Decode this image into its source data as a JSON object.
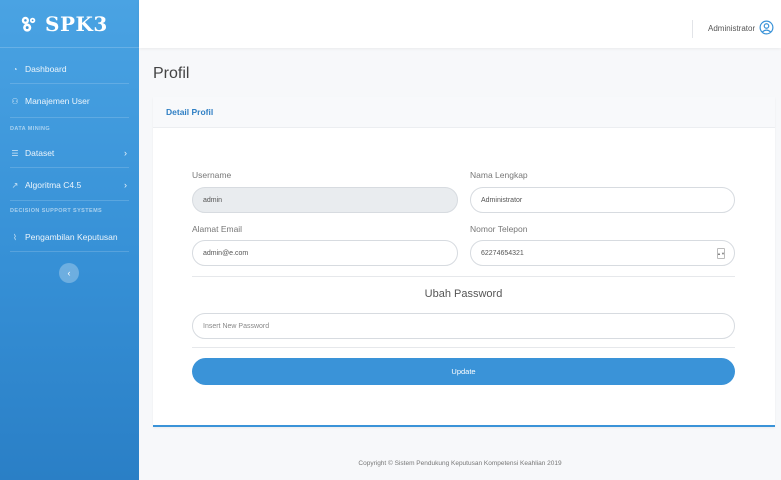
{
  "brand": {
    "name": "SPK3",
    "logo_icon": "gear-cluster-icon"
  },
  "sidebar": {
    "items": [
      {
        "label": "Dashboard",
        "icon": "dashboard-icon"
      },
      {
        "label": "Manajemen User",
        "icon": "users-icon"
      },
      {
        "label": "Dataset",
        "icon": "database-icon"
      },
      {
        "label": "Algoritma C4.5",
        "icon": "wrench-icon"
      },
      {
        "label": "Pengambilan Keputusan",
        "icon": "chart-line-icon"
      }
    ],
    "sections": [
      "DATA MINING",
      "DECISION SUPPORT SYSTEMS"
    ],
    "collapse_icon": "‹"
  },
  "header": {
    "user_name": "Administrator",
    "user_icon": "user-circle-icon"
  },
  "page": {
    "title": "Profil"
  },
  "card": {
    "title": "Detail Profil",
    "username_label": "Username",
    "username_value": "admin",
    "fullname_label": "Nama Lengkap",
    "fullname_value": "Administrator",
    "email_label": "Alamat Email",
    "email_value": "admin@e.com",
    "phone_label": "Nomor Telepon",
    "phone_value": "62274654321",
    "password_section": "Ubah Password",
    "password_placeholder": "Insert New Password",
    "update_label": "Update"
  },
  "footer": {
    "text": "Copyright © Sistem Pendukung Keputusan Kompetensi Keahlian 2019"
  },
  "colors": {
    "primary": "#3a93d8",
    "sidebar_top": "#4aa3e3",
    "sidebar_bottom": "#2a7fc6",
    "card_title": "#2f7fc4"
  }
}
